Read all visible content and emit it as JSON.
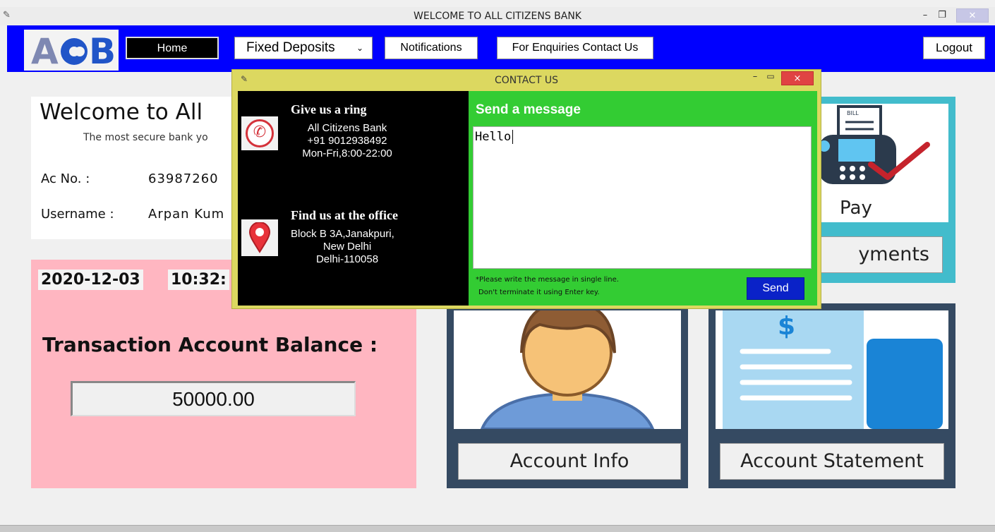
{
  "window": {
    "title": "WELCOME TO ALL CITIZENS BANK",
    "min_symbol": "–",
    "max_symbol": "❐",
    "close_symbol": "✕"
  },
  "logo": {
    "letter_a": "A",
    "letter_b": "B"
  },
  "nav": {
    "home": "Home",
    "fixed_deposits": "Fixed Deposits",
    "notifications": "Notifications",
    "enquiries": "For Enquiries Contact Us",
    "logout": "Logout"
  },
  "welcome": {
    "heading": "Welcome to All",
    "tagline": "The most secure bank yo",
    "acno_label": "Ac No. :",
    "acno_value": "63987260",
    "username_label": "Username :",
    "username_value": "Arpan Kum"
  },
  "balance": {
    "date": "2020-12-03",
    "time": "10:32:",
    "title": "Transaction Account Balance :",
    "amount": "50000.00"
  },
  "tiles": {
    "bill_caption": "yments",
    "bill_image_text": "Pay",
    "bill_label": "BILL",
    "account_info": "Account Info",
    "account_statement": "Account Statement",
    "dollar": "$"
  },
  "dialog": {
    "title": "CONTACT US",
    "ring_heading": "Give us a ring",
    "ring_line1": "All Citizens Bank",
    "ring_line2": "+91 9012938492",
    "ring_line3": "Mon-Fri,8:00-22:00",
    "office_heading": "Find us at the office",
    "office_line1": "Block B 3A,Janakpuri,",
    "office_line2": "New Delhi",
    "office_line3": "Delhi-110058",
    "send_heading": "Send a message",
    "message_value": "Hello",
    "note_line1": "*Please write the message in single line.",
    "note_line2": "Don't terminate it using Enter key.",
    "send_button": "Send",
    "close_symbol": "×"
  },
  "colors": {
    "nav_bg": "#0000ff",
    "dialog_bg": "#dcd860",
    "dialog_right_bg": "#33cc33",
    "balance_bg": "#ffb6c1",
    "tile_bill_bg": "#42bccc",
    "tile_dark_bg": "#354a62",
    "send_btn": "#0a22c8"
  }
}
